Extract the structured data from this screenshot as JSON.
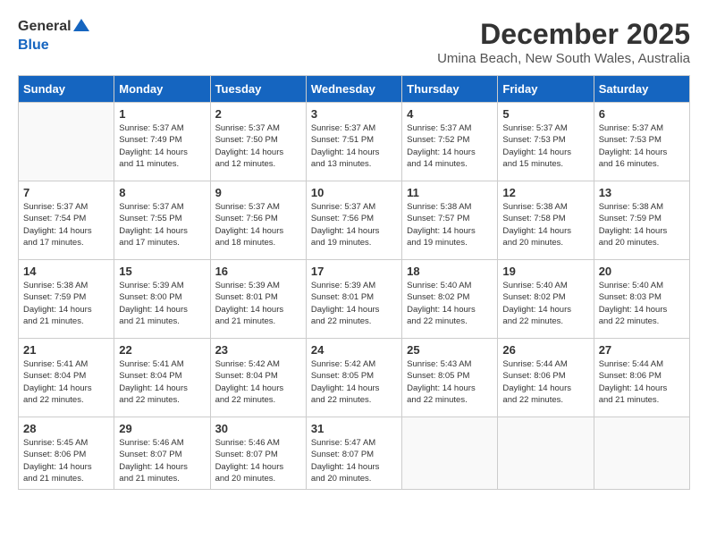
{
  "header": {
    "logo_general": "General",
    "logo_blue": "Blue",
    "month_title": "December 2025",
    "location": "Umina Beach, New South Wales, Australia"
  },
  "days_of_week": [
    "Sunday",
    "Monday",
    "Tuesday",
    "Wednesday",
    "Thursday",
    "Friday",
    "Saturday"
  ],
  "weeks": [
    [
      {
        "day": "",
        "info": ""
      },
      {
        "day": "1",
        "info": "Sunrise: 5:37 AM\nSunset: 7:49 PM\nDaylight: 14 hours\nand 11 minutes."
      },
      {
        "day": "2",
        "info": "Sunrise: 5:37 AM\nSunset: 7:50 PM\nDaylight: 14 hours\nand 12 minutes."
      },
      {
        "day": "3",
        "info": "Sunrise: 5:37 AM\nSunset: 7:51 PM\nDaylight: 14 hours\nand 13 minutes."
      },
      {
        "day": "4",
        "info": "Sunrise: 5:37 AM\nSunset: 7:52 PM\nDaylight: 14 hours\nand 14 minutes."
      },
      {
        "day": "5",
        "info": "Sunrise: 5:37 AM\nSunset: 7:53 PM\nDaylight: 14 hours\nand 15 minutes."
      },
      {
        "day": "6",
        "info": "Sunrise: 5:37 AM\nSunset: 7:53 PM\nDaylight: 14 hours\nand 16 minutes."
      }
    ],
    [
      {
        "day": "7",
        "info": "Sunrise: 5:37 AM\nSunset: 7:54 PM\nDaylight: 14 hours\nand 17 minutes."
      },
      {
        "day": "8",
        "info": "Sunrise: 5:37 AM\nSunset: 7:55 PM\nDaylight: 14 hours\nand 17 minutes."
      },
      {
        "day": "9",
        "info": "Sunrise: 5:37 AM\nSunset: 7:56 PM\nDaylight: 14 hours\nand 18 minutes."
      },
      {
        "day": "10",
        "info": "Sunrise: 5:37 AM\nSunset: 7:56 PM\nDaylight: 14 hours\nand 19 minutes."
      },
      {
        "day": "11",
        "info": "Sunrise: 5:38 AM\nSunset: 7:57 PM\nDaylight: 14 hours\nand 19 minutes."
      },
      {
        "day": "12",
        "info": "Sunrise: 5:38 AM\nSunset: 7:58 PM\nDaylight: 14 hours\nand 20 minutes."
      },
      {
        "day": "13",
        "info": "Sunrise: 5:38 AM\nSunset: 7:59 PM\nDaylight: 14 hours\nand 20 minutes."
      }
    ],
    [
      {
        "day": "14",
        "info": "Sunrise: 5:38 AM\nSunset: 7:59 PM\nDaylight: 14 hours\nand 21 minutes."
      },
      {
        "day": "15",
        "info": "Sunrise: 5:39 AM\nSunset: 8:00 PM\nDaylight: 14 hours\nand 21 minutes."
      },
      {
        "day": "16",
        "info": "Sunrise: 5:39 AM\nSunset: 8:01 PM\nDaylight: 14 hours\nand 21 minutes."
      },
      {
        "day": "17",
        "info": "Sunrise: 5:39 AM\nSunset: 8:01 PM\nDaylight: 14 hours\nand 22 minutes."
      },
      {
        "day": "18",
        "info": "Sunrise: 5:40 AM\nSunset: 8:02 PM\nDaylight: 14 hours\nand 22 minutes."
      },
      {
        "day": "19",
        "info": "Sunrise: 5:40 AM\nSunset: 8:02 PM\nDaylight: 14 hours\nand 22 minutes."
      },
      {
        "day": "20",
        "info": "Sunrise: 5:40 AM\nSunset: 8:03 PM\nDaylight: 14 hours\nand 22 minutes."
      }
    ],
    [
      {
        "day": "21",
        "info": "Sunrise: 5:41 AM\nSunset: 8:04 PM\nDaylight: 14 hours\nand 22 minutes."
      },
      {
        "day": "22",
        "info": "Sunrise: 5:41 AM\nSunset: 8:04 PM\nDaylight: 14 hours\nand 22 minutes."
      },
      {
        "day": "23",
        "info": "Sunrise: 5:42 AM\nSunset: 8:04 PM\nDaylight: 14 hours\nand 22 minutes."
      },
      {
        "day": "24",
        "info": "Sunrise: 5:42 AM\nSunset: 8:05 PM\nDaylight: 14 hours\nand 22 minutes."
      },
      {
        "day": "25",
        "info": "Sunrise: 5:43 AM\nSunset: 8:05 PM\nDaylight: 14 hours\nand 22 minutes."
      },
      {
        "day": "26",
        "info": "Sunrise: 5:44 AM\nSunset: 8:06 PM\nDaylight: 14 hours\nand 22 minutes."
      },
      {
        "day": "27",
        "info": "Sunrise: 5:44 AM\nSunset: 8:06 PM\nDaylight: 14 hours\nand 21 minutes."
      }
    ],
    [
      {
        "day": "28",
        "info": "Sunrise: 5:45 AM\nSunset: 8:06 PM\nDaylight: 14 hours\nand 21 minutes."
      },
      {
        "day": "29",
        "info": "Sunrise: 5:46 AM\nSunset: 8:07 PM\nDaylight: 14 hours\nand 21 minutes."
      },
      {
        "day": "30",
        "info": "Sunrise: 5:46 AM\nSunset: 8:07 PM\nDaylight: 14 hours\nand 20 minutes."
      },
      {
        "day": "31",
        "info": "Sunrise: 5:47 AM\nSunset: 8:07 PM\nDaylight: 14 hours\nand 20 minutes."
      },
      {
        "day": "",
        "info": ""
      },
      {
        "day": "",
        "info": ""
      },
      {
        "day": "",
        "info": ""
      }
    ]
  ]
}
